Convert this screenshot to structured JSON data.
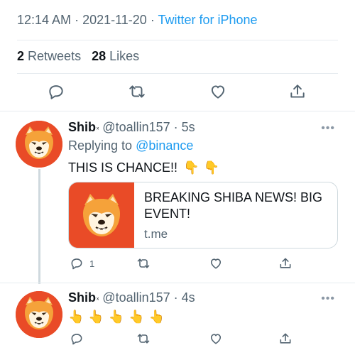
{
  "tweet_meta": {
    "time": "12:14 AM",
    "separator": " · ",
    "date": "2021-11-20",
    "source": "Twitter for iPhone"
  },
  "stats": {
    "retweets_count": "2",
    "retweets_label": "Retweets",
    "likes_count": "28",
    "likes_label": "Likes"
  },
  "replies": [
    {
      "name": "Shib",
      "badge": "ₓ",
      "handle": "@toallin157",
      "time": "· 5s",
      "replying_label": "Replying to",
      "replying_to": "@binance",
      "text": "THIS IS  CHANCE!!",
      "emojis": [
        "👇",
        "👇"
      ],
      "card": {
        "title": "BREAKING SHIBA NEWS! BIG EVENT!",
        "domain": "t.me"
      },
      "reply_count": "1"
    },
    {
      "name": "Shib",
      "badge": "ₓ",
      "handle": "@toallin157",
      "time": "· 4s",
      "emojis": [
        "👆",
        "👆",
        "👆",
        "👆",
        "👆"
      ]
    }
  ],
  "more_glyph": "•••",
  "colors": {
    "accent": "#1d9bf0",
    "muted": "#536471",
    "avatar_bg": "#e94b27",
    "divider": "#e6ecf0"
  },
  "icons": {
    "reply": "reply-icon",
    "retweet": "retweet-icon",
    "like": "like-icon",
    "share": "share-icon",
    "more": "more-icon"
  }
}
